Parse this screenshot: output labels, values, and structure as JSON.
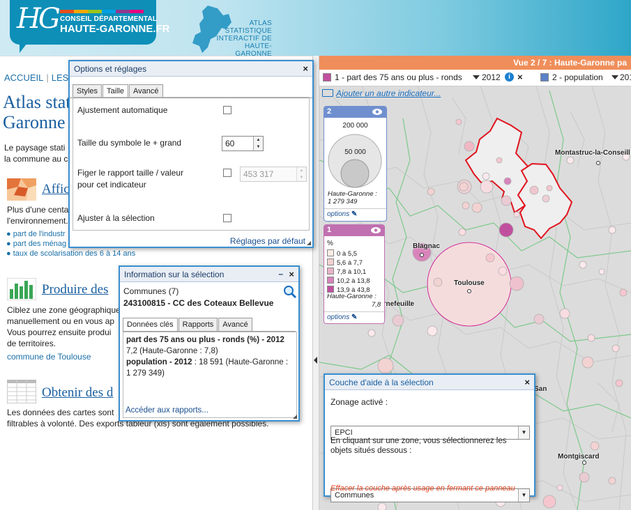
{
  "header": {
    "logo_mark": "HG",
    "logo_line1": "CONSEIL DÉPARTEMENTAL",
    "logo_line2": "HAUTE-GARONNE.FR",
    "atlas_title": [
      "ATLAS",
      "STATISTIQUE",
      "INTERACTIF DE",
      "HAUTE-GARONNE"
    ],
    "stripe_colors": [
      "#e94e1b",
      "#f6a800",
      "#9dc41a",
      "#00a0e3",
      "#8e3b8f",
      "#e6007e"
    ]
  },
  "nav": {
    "home": "ACCUEIL",
    "next": "LES"
  },
  "left": {
    "title_lines": [
      "Atlas stat",
      "Garonne"
    ],
    "intro_lines": [
      "Le paysage stati",
      "la commune au c"
    ],
    "section1": {
      "title": "Affic",
      "text_lines": [
        "Plus d'une centa",
        "l'environnement."
      ],
      "links": [
        "part de l'industr",
        "part des ménag",
        "taux de scolarisation des 6 à 14 ans"
      ]
    },
    "section2": {
      "title": "Produire des",
      "text_lines": [
        "Ciblez une zone géographique",
        "manuellement ou en vous ap",
        "Vous pourrez ensuite produi",
        "de territoires."
      ],
      "link": "commune de Toulouse"
    },
    "section3": {
      "title": "Obtenir des d",
      "text_lines": [
        "Les données des cartes sont",
        "filtrables à volonté. Des exports tableur (xls) sont également possibles."
      ]
    }
  },
  "map": {
    "view_label": "Vue 2 / 7 : Haute-Garonne pa",
    "indicator1": {
      "label": "1 - part des 75 ans ou plus - ronds",
      "year": "2012",
      "color": "#c0509e"
    },
    "indicator2": {
      "label": "2 - population",
      "year": "201",
      "color": "#5b82c8"
    },
    "add_indicator": "Ajouter un autre indicateur...",
    "places": [
      "Montastruc-la-Conseill",
      "Blagnac",
      "Toulouse",
      "Tournefeuille",
      "Montgiscard",
      "San"
    ],
    "legend2": {
      "number": "2",
      "values": [
        "200 000",
        "50 000"
      ],
      "total_label": "Haute-Garonne :",
      "total_value": "1 279 349",
      "options": "options"
    },
    "legend1": {
      "number": "1",
      "unit": "%",
      "classes": [
        {
          "label": "0 à 5,5",
          "color": "#fbeee4"
        },
        {
          "label": "5,6 à 7,7",
          "color": "#f3d2d2"
        },
        {
          "label": "7,8 à 10,1",
          "color": "#e8b4c8"
        },
        {
          "label": "10,2 à 13,8",
          "color": "#d884bb"
        },
        {
          "label": "13,9 à 43,8",
          "color": "#c0509e"
        }
      ],
      "total_label": "Haute-Garonne :",
      "total_value": "7,8",
      "options": "options"
    }
  },
  "options_panel": {
    "title": "Options et réglages",
    "tabs": [
      "Styles",
      "Taille",
      "Avancé"
    ],
    "active_tab": "Taille",
    "auto_adjust": "Ajustement automatique",
    "max_symbol_label": "Taille du symbole le + grand",
    "max_symbol_value": "60",
    "fix_ratio_label_lines": [
      "Figer le rapport taille / valeur",
      "pour cet indicateur"
    ],
    "fix_ratio_value": "453 317",
    "adjust_selection": "Ajuster à la sélection",
    "default_link": "Réglages par défaut"
  },
  "info_panel": {
    "title": "Information sur la sélection",
    "selection_count": "Communes (7)",
    "selection_name": "243100815 - CC des Coteaux Bellevue",
    "tabs": [
      "Données clés",
      "Rapports",
      "Avancé"
    ],
    "active_tab": "Données clés",
    "ind1_title": "part des 75 ans ou plus - ronds (%) - 2012",
    "ind1_value": "7,2 (Haute-Garonne : 7,8)",
    "ind2_title": "population - 2012",
    "ind2_value_lines": [
      ": 18 591 (Haute-Garonne :",
      "1 279 349)"
    ],
    "reports_link": "Accéder aux rapports..."
  },
  "help_panel": {
    "title": "Couche d'aide à la sélection",
    "zoning_label": "Zonage activé :",
    "zoning_value": "EPCI",
    "hint_lines": [
      "En cliquant sur une zone, vous sélectionnerez les",
      "objets situés dessous :"
    ],
    "objects_value": "Communes",
    "footer": "Effacer la couche après usage en fermant ce panneau"
  }
}
